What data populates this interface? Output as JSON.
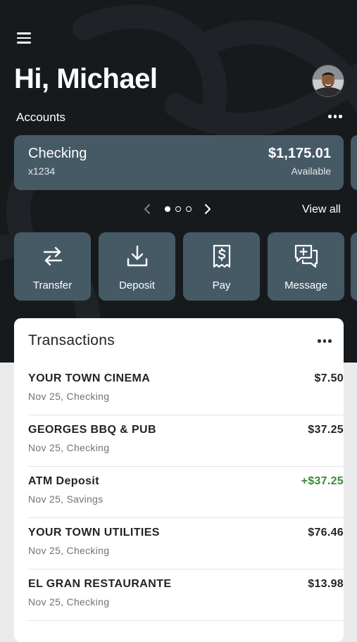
{
  "header": {
    "greeting": "Hi, Michael",
    "accounts_label": "Accounts"
  },
  "account_carousel": {
    "current": {
      "name": "Checking",
      "number": "x1234",
      "balance": "$1,175.01",
      "balance_label": "Available"
    },
    "page_count": 3,
    "current_page": 1,
    "view_all_label": "View all"
  },
  "actions": [
    {
      "label": "Transfer",
      "icon": "transfer-icon"
    },
    {
      "label": "Deposit",
      "icon": "deposit-icon"
    },
    {
      "label": "Pay",
      "icon": "receipt-dollar-icon"
    },
    {
      "label": "Message",
      "icon": "message-add-icon"
    }
  ],
  "transactions": {
    "title": "Transactions",
    "items": [
      {
        "merchant": "YOUR TOWN CINEMA",
        "meta": "Nov 25, Checking",
        "amount": "$7.50",
        "positive": false
      },
      {
        "merchant": "GEORGES BBQ & PUB",
        "meta": "Nov 25, Checking",
        "amount": "$37.25",
        "positive": false
      },
      {
        "merchant": "ATM Deposit",
        "meta": "Nov 25, Savings",
        "amount": "+$37.25",
        "positive": true
      },
      {
        "merchant": "YOUR TOWN UTILITIES",
        "meta": "Nov 25, Checking",
        "amount": "$76.46",
        "positive": false
      },
      {
        "merchant": "EL GRAN RESTAURANTE",
        "meta": "Nov 25, Checking",
        "amount": "$13.98",
        "positive": false
      }
    ]
  },
  "colors": {
    "hero_background": "#171a1d",
    "card_background": "#465a66",
    "positive_amount": "#3a8a37"
  }
}
